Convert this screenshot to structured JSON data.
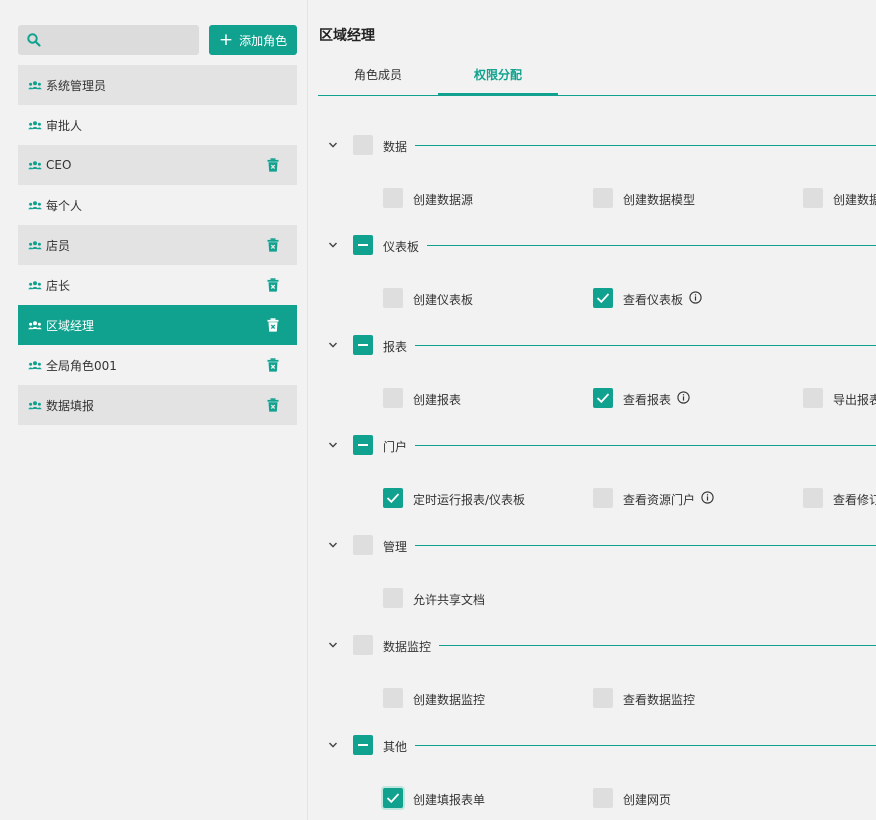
{
  "search": {
    "placeholder": "",
    "value": ""
  },
  "add_button": {
    "label": "添加角色"
  },
  "roles": [
    {
      "label": "系统管理员",
      "deletable": false,
      "active": false
    },
    {
      "label": "审批人",
      "deletable": false,
      "active": false
    },
    {
      "label": "CEO",
      "deletable": true,
      "active": false
    },
    {
      "label": "每个人",
      "deletable": false,
      "active": false
    },
    {
      "label": "店员",
      "deletable": true,
      "active": false
    },
    {
      "label": "店长",
      "deletable": true,
      "active": false
    },
    {
      "label": "区域经理",
      "deletable": true,
      "active": true
    },
    {
      "label": "全局角色001",
      "deletable": true,
      "active": false
    },
    {
      "label": "数据填报",
      "deletable": true,
      "active": false
    }
  ],
  "main": {
    "title": "区域经理",
    "tabs": [
      {
        "label": "角色成员",
        "active": false
      },
      {
        "label": "权限分配",
        "active": true
      }
    ]
  },
  "groups": [
    {
      "name": "数据",
      "state": "unchecked",
      "items": [
        {
          "label": "创建数据源",
          "checked": false,
          "info": false
        },
        {
          "label": "创建数据模型",
          "checked": false,
          "info": false
        },
        {
          "label": "创建数据",
          "checked": false,
          "info": false
        }
      ]
    },
    {
      "name": "仪表板",
      "state": "partial",
      "items": [
        {
          "label": "创建仪表板",
          "checked": false,
          "info": false
        },
        {
          "label": "查看仪表板",
          "checked": true,
          "info": true
        }
      ]
    },
    {
      "name": "报表",
      "state": "partial",
      "items": [
        {
          "label": "创建报表",
          "checked": false,
          "info": false
        },
        {
          "label": "查看报表",
          "checked": true,
          "info": true
        },
        {
          "label": "导出报表",
          "checked": false,
          "info": false
        }
      ]
    },
    {
      "name": "门户",
      "state": "partial",
      "items": [
        {
          "label": "定时运行报表/仪表板",
          "checked": true,
          "info": false
        },
        {
          "label": "查看资源门户",
          "checked": false,
          "info": true
        },
        {
          "label": "查看修订",
          "checked": false,
          "info": false
        }
      ]
    },
    {
      "name": "管理",
      "state": "unchecked",
      "items": [
        {
          "label": "允许共享文档",
          "checked": false,
          "info": false
        }
      ]
    },
    {
      "name": "数据监控",
      "state": "unchecked",
      "items": [
        {
          "label": "创建数据监控",
          "checked": false,
          "info": false
        },
        {
          "label": "查看数据监控",
          "checked": false,
          "info": false
        }
      ]
    },
    {
      "name": "其他",
      "state": "partial",
      "items": [
        {
          "label": "创建填报表单",
          "checked": true,
          "info": false
        },
        {
          "label": "创建网页",
          "checked": false,
          "info": false
        }
      ]
    }
  ],
  "colors": {
    "accent": "#11a28f",
    "background": "#f2f2f2",
    "checkbox_off": "#dedede"
  },
  "icons": {
    "search": "search-icon",
    "add": "plus-icon",
    "role": "users-icon",
    "delete": "trash-icon",
    "collapse": "chevron-down-icon",
    "info": "info-icon",
    "check": "check-icon"
  }
}
